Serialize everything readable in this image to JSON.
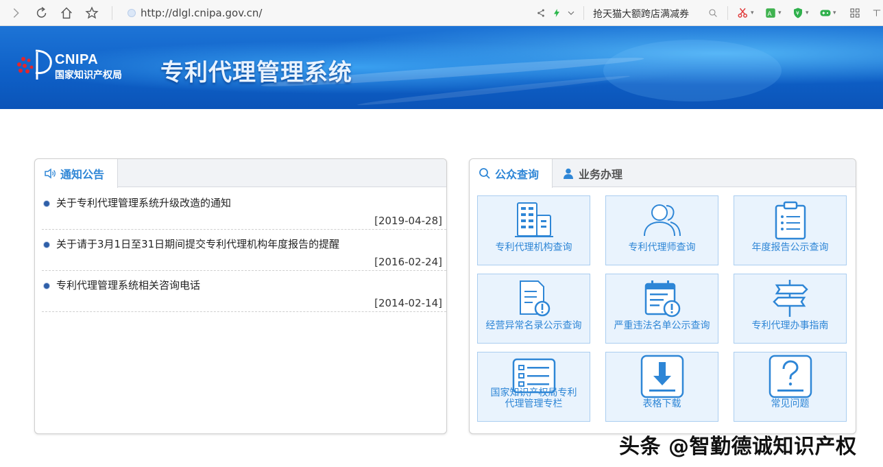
{
  "browser": {
    "url": "http://dlgl.cnipa.gov.cn/",
    "promo_text": "抢天猫大额跨店满减券"
  },
  "banner": {
    "logo_en": "CNIPA",
    "logo_cn": "国家知识产权局",
    "title": "专利代理管理系统"
  },
  "notice_panel": {
    "tab_label": "通知公告",
    "items": [
      {
        "title": "关于专利代理管理系统升级改造的通知",
        "date": "[2019-04-28]"
      },
      {
        "title": "关于请于3月1日至31日期间提交专利代理机构年度报告的提醒",
        "date": "[2016-02-24]"
      },
      {
        "title": "专利代理管理系统相关咨询电话",
        "date": "[2014-02-14]"
      }
    ]
  },
  "service_panel": {
    "tabs": [
      {
        "label": "公众查询",
        "icon": "search-icon"
      },
      {
        "label": "业务办理",
        "icon": "user-icon"
      }
    ],
    "tiles": [
      {
        "label": "专利代理机构查询",
        "icon": "building-icon"
      },
      {
        "label": "专利代理师查询",
        "icon": "people-icon"
      },
      {
        "label": "年度报告公示查询",
        "icon": "clipboard-icon"
      },
      {
        "label": "经营异常名录公示查询",
        "icon": "document-alert-icon"
      },
      {
        "label": "严重违法名单公示查询",
        "icon": "calendar-alert-icon"
      },
      {
        "label": "专利代理办事指南",
        "icon": "signpost-icon"
      },
      {
        "label_line1": "国家知识产权局专利",
        "label_line2": "代理管理专栏",
        "icon": "list-icon"
      },
      {
        "label": "表格下载",
        "icon": "download-icon"
      },
      {
        "label": "常见问题",
        "icon": "question-icon"
      }
    ]
  },
  "watermark": "头条 @智勤德诚知识产权",
  "colors": {
    "accent": "#2e86d6",
    "tile_bg": "#e9f3fd",
    "tile_border": "#a9cdf0",
    "banner": "#0e5fc6"
  }
}
